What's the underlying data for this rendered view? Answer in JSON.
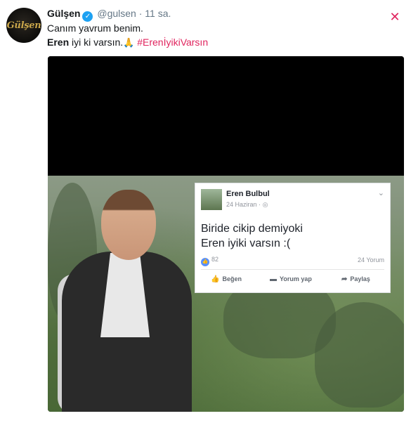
{
  "tweet": {
    "author_name": "Gülşen",
    "author_handle": "@gulsen",
    "separator": "·",
    "time": "11 sa.",
    "avatar_text": "Gülşen",
    "line1": "Canım yavrum benim.",
    "line2_bold": "Eren",
    "line2_text": "iyi ki varsın.",
    "line2_emoji": "🙏",
    "hashtag": "#ErenİyikiVarsın",
    "verified_glyph": "✓",
    "caret_glyph": "✕"
  },
  "facebook_post": {
    "name": "Eren Bulbul",
    "date": "24 Haziran",
    "meta_sep": "·",
    "globe_glyph": "◎",
    "chevron_glyph": "⌄",
    "text_line1": "Biride cikip demiyoki",
    "text_line2": "Eren iyiki varsın :(",
    "likes": "82",
    "like_glyph": "👍",
    "comments": "24 Yorum",
    "actions": {
      "like": "Beğen",
      "comment": "Yorum yap",
      "share": "Paylaş"
    },
    "action_icons": {
      "like": "👍",
      "comment": "▬",
      "share": "➦"
    }
  },
  "colors": {
    "accent": "#e0245e",
    "verified": "#1da1f2",
    "fb_like": "#5890ff"
  }
}
